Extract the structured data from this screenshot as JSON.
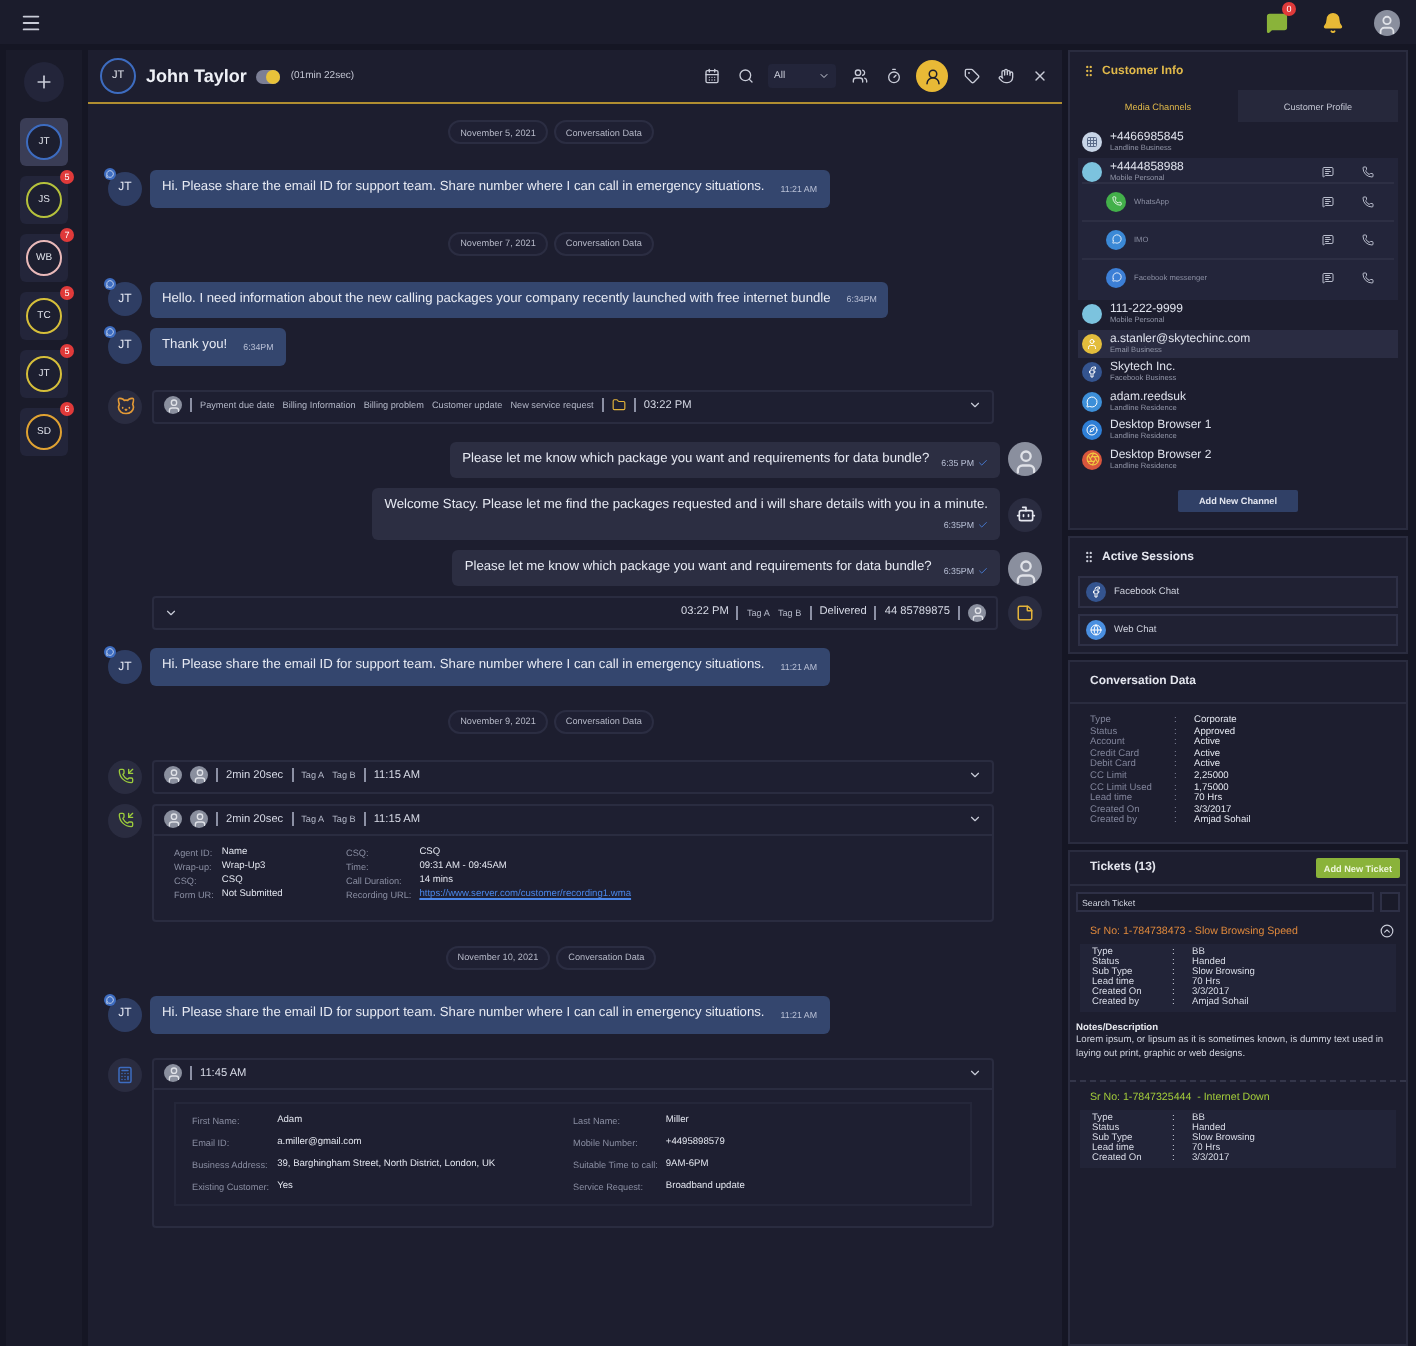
{
  "top_bar": {
    "chat_badge": "0"
  },
  "rail": [
    {
      "initials": "JT",
      "color": "#3d6cc0",
      "selected": true
    },
    {
      "initials": "JS",
      "badge": "5",
      "color": "#b6c23c",
      "selected": false
    },
    {
      "initials": "WB",
      "badge": "7",
      "color": "#e9b9b9",
      "selected": false
    },
    {
      "initials": "TC",
      "badge": "5",
      "color": "#d6bf3a",
      "selected": false
    },
    {
      "initials": "JT",
      "badge": "5",
      "color": "#d6bf3a",
      "selected": false
    },
    {
      "initials": "SD",
      "badge": "6",
      "color": "#e0a232",
      "selected": false
    }
  ],
  "chat": {
    "initials": "JT",
    "name": "John Taylor",
    "live": true,
    "duration": "(01min 22sec)",
    "filter": "All",
    "tools": [
      {
        "kind": "calendar",
        "active": false
      },
      {
        "kind": "search",
        "active": false
      },
      {
        "kind": "filter"
      },
      {
        "kind": "group",
        "active": false
      },
      {
        "kind": "timer",
        "active": false
      },
      {
        "kind": "assign",
        "active": true
      },
      {
        "kind": "label",
        "active": false
      },
      {
        "kind": "hand",
        "active": false
      },
      {
        "kind": "close",
        "active": false
      }
    ],
    "messages": [
      {
        "kind": "date",
        "date": "November 5, 2021",
        "label": "Conversation Data"
      },
      {
        "kind": "incoming",
        "initials": "JT",
        "text": "Hi. Please share the email ID for support team. Share number where I can call in emergency situations.",
        "time": "11:21 AM"
      },
      {
        "kind": "date",
        "date": "November 7, 2021",
        "label": "Conversation Data"
      },
      {
        "kind": "incoming",
        "initials": "JT",
        "text": "Hello. I need information about the new calling packages your company recently launched with free internet bundle",
        "time": "6:34PM"
      },
      {
        "kind": "incoming",
        "initials": "JT",
        "text": "Thank you!",
        "time": "6:34PM"
      },
      {
        "kind": "summary",
        "tags": [
          "Payment due date",
          "Billing Information",
          "Billing problem",
          "Customer update",
          "New service request"
        ],
        "time": "03:22 PM"
      },
      {
        "kind": "outgoing",
        "text": "Please let me know which package you want and requirements for data bundle?",
        "time": "6:35 PM",
        "read": true
      },
      {
        "kind": "bot",
        "text": "Welcome Stacy. Please let me find the packages requested and i will share details with you in a minute.",
        "time": "6:35PM",
        "read": true
      },
      {
        "kind": "outgoing",
        "text": "Please let me know which package you want and requirements for data bundle?",
        "time": "6:35PM",
        "read": true
      },
      {
        "kind": "status",
        "time": "03:22 PM",
        "tags": [
          "Tag A",
          "Tag B"
        ],
        "status": "Delivered",
        "number": "44 85789875"
      },
      {
        "kind": "incoming",
        "initials": "JT",
        "text": "Hi. Please share the email ID for support team. Share number where I can call in emergency situations.",
        "time": "11:21 AM"
      },
      {
        "kind": "date",
        "date": "November 9, 2021",
        "label": "Conversation Data"
      },
      {
        "kind": "call",
        "duration": "2min 20sec",
        "tags": [
          "Tag A",
          "Tag B"
        ],
        "time": "11:15 AM",
        "expanded": false
      },
      {
        "kind": "call",
        "duration": "2min 20sec",
        "tags": [
          "Tag A",
          "Tag B"
        ],
        "time": "11:15 AM",
        "expanded": true,
        "columns": [
          [
            {
              "label": "Agent ID:",
              "value": "Name"
            },
            {
              "label": "Wrap-up:",
              "value": "Wrap-Up3"
            },
            {
              "label": "CSQ:",
              "value": "CSQ"
            },
            {
              "label": "Form UR:",
              "value": "Not Submitted"
            }
          ],
          [
            {
              "label": "CSQ:",
              "value": "CSQ"
            },
            {
              "label": "Time:",
              "value": "09:31 AM - 09:45AM"
            },
            {
              "label": "Call Duration:",
              "value": "14 mins"
            },
            {
              "label": "Recording URL:",
              "value": "https://www.server.com/customer/recording1.wma",
              "kind": "link"
            }
          ]
        ]
      },
      {
        "kind": "date",
        "date": "November 10, 2021",
        "label": "Conversation Data"
      },
      {
        "kind": "incoming",
        "initials": "JT",
        "text": "Hi. Please share the email ID for support team. Share number where I can call in emergency situations.",
        "time": "11:21 AM"
      },
      {
        "kind": "form",
        "time": "11:45 AM",
        "columns": [
          [
            {
              "label": "First Name:",
              "value": "Adam"
            },
            {
              "label": "Email ID:",
              "value": "a.miller@gmail.com"
            },
            {
              "label": "Business Address:",
              "value": "39, Barghingham Street, North District, London, UK"
            },
            {
              "label": "Existing Customer:",
              "value": "Yes"
            }
          ],
          [
            {
              "label": "Last Name:",
              "value": "Miller"
            },
            {
              "label": "Mobile Number:",
              "value": "+4495898579"
            },
            {
              "label": "Suitable Time to call:",
              "value": "9AM-6PM"
            },
            {
              "label": "Service Request:",
              "value": "Broadband update"
            }
          ]
        ]
      }
    ]
  },
  "customer_info": {
    "title": "Customer Info",
    "tabs": [
      {
        "label": "Media Channels",
        "selected": true
      },
      {
        "label": "Customer Profile",
        "selected": false
      }
    ],
    "channels": [
      {
        "kind": "landline",
        "value": "+4466985845",
        "type": "Landline Business",
        "selected": false,
        "expanded": false
      },
      {
        "kind": "phone",
        "value": "+4444858988",
        "type": "Mobile Personal",
        "selected": false,
        "expanded": true,
        "apps": [
          {
            "kind": "whatsapp",
            "name": "WhatsApp"
          },
          {
            "kind": "imo",
            "name": "IMO"
          },
          {
            "kind": "messenger",
            "name": "Facebook messenger"
          }
        ]
      },
      {
        "kind": "phone",
        "value": "111-222-9999",
        "type": "Mobile Personal",
        "selected": false,
        "expanded": false
      },
      {
        "kind": "email",
        "value": "a.stanler@skytechinc.com",
        "type": "Email Business",
        "selected": true,
        "expanded": false
      },
      {
        "kind": "facebook",
        "value": "Skytech Inc.",
        "type": "Facebook Business",
        "selected": false,
        "expanded": false
      },
      {
        "kind": "skype",
        "value": "adam.reedsuk",
        "type": "Landline Residence",
        "selected": false,
        "expanded": false
      },
      {
        "kind": "browser",
        "value": "Desktop Browser 1",
        "type": "Landline Residence",
        "selected": false,
        "expanded": false
      },
      {
        "kind": "chrome",
        "value": "Desktop Browser 2",
        "type": "Landline Residence",
        "selected": false,
        "expanded": false
      }
    ],
    "add_button": "Add New Channel"
  },
  "active_sessions": {
    "title": "Active Sessions",
    "items": [
      {
        "kind": "facebook",
        "label": "Facebook Chat"
      },
      {
        "kind": "web",
        "label": "Web Chat"
      }
    ]
  },
  "conversation_data": {
    "title": "Conversation Data",
    "rows": [
      {
        "label": "Type",
        "sep": ":",
        "value": "Corporate"
      },
      {
        "label": "Status",
        "sep": ":",
        "value": "Approved"
      },
      {
        "label": "Account",
        "sep": ":",
        "value": "Active"
      },
      {
        "label": "Credit Card",
        "sep": ":",
        "value": "Active"
      },
      {
        "label": "Debit Card",
        "sep": ":",
        "value": "Active"
      },
      {
        "label": "CC Limit",
        "sep": ":",
        "value": "2,25000"
      },
      {
        "label": "CC Limit Used",
        "sep": ":",
        "value": "1,75000"
      },
      {
        "label": "Lead time",
        "sep": ":",
        "value": "70 Hrs"
      },
      {
        "label": "Created On",
        "sep": ":",
        "value": "3/3/2017"
      },
      {
        "label": "Created by",
        "sep": ":",
        "value": "Amjad Sohail"
      }
    ]
  },
  "tickets": {
    "title": "Tickets (13)",
    "add_button": "Add New Ticket",
    "search_placeholder": "Search Ticket",
    "items": [
      {
        "title": "Sr No: 1-784738473 - Slow Browsing Speed",
        "color": "#e0893c",
        "toggle": true,
        "fields": [
          {
            "label": "Type",
            "sep": ":",
            "value": "BB"
          },
          {
            "label": "Status",
            "sep": ":",
            "value": "Handed"
          },
          {
            "label": "Sub Type",
            "sep": ":",
            "value": "Slow Browsing"
          },
          {
            "label": "Lead time",
            "sep": ":",
            "value": "70 Hrs"
          },
          {
            "label": "Created On",
            "sep": ":",
            "value": "3/3/2017"
          },
          {
            "label": "Created by",
            "sep": ":",
            "value": "Amjad Sohail"
          }
        ],
        "notes_title": "Notes/Description",
        "notes": "Lorem ipsum, or lipsum as it is sometimes known, is dummy text used in laying out print, graphic or web designs."
      },
      {
        "title": "Sr No: 1-7847325444  - Internet Down",
        "color": "#a3cc3a",
        "toggle": false,
        "fields": [
          {
            "label": "Type",
            "sep": ":",
            "value": "BB"
          },
          {
            "label": "Status",
            "sep": ":",
            "value": "Handed"
          },
          {
            "label": "Sub Type",
            "sep": ":",
            "value": "Slow Browsing"
          },
          {
            "label": "Lead time",
            "sep": ":",
            "value": "70 Hrs"
          },
          {
            "label": "Created On",
            "sep": ":",
            "value": "3/3/2017"
          }
        ]
      }
    ]
  }
}
